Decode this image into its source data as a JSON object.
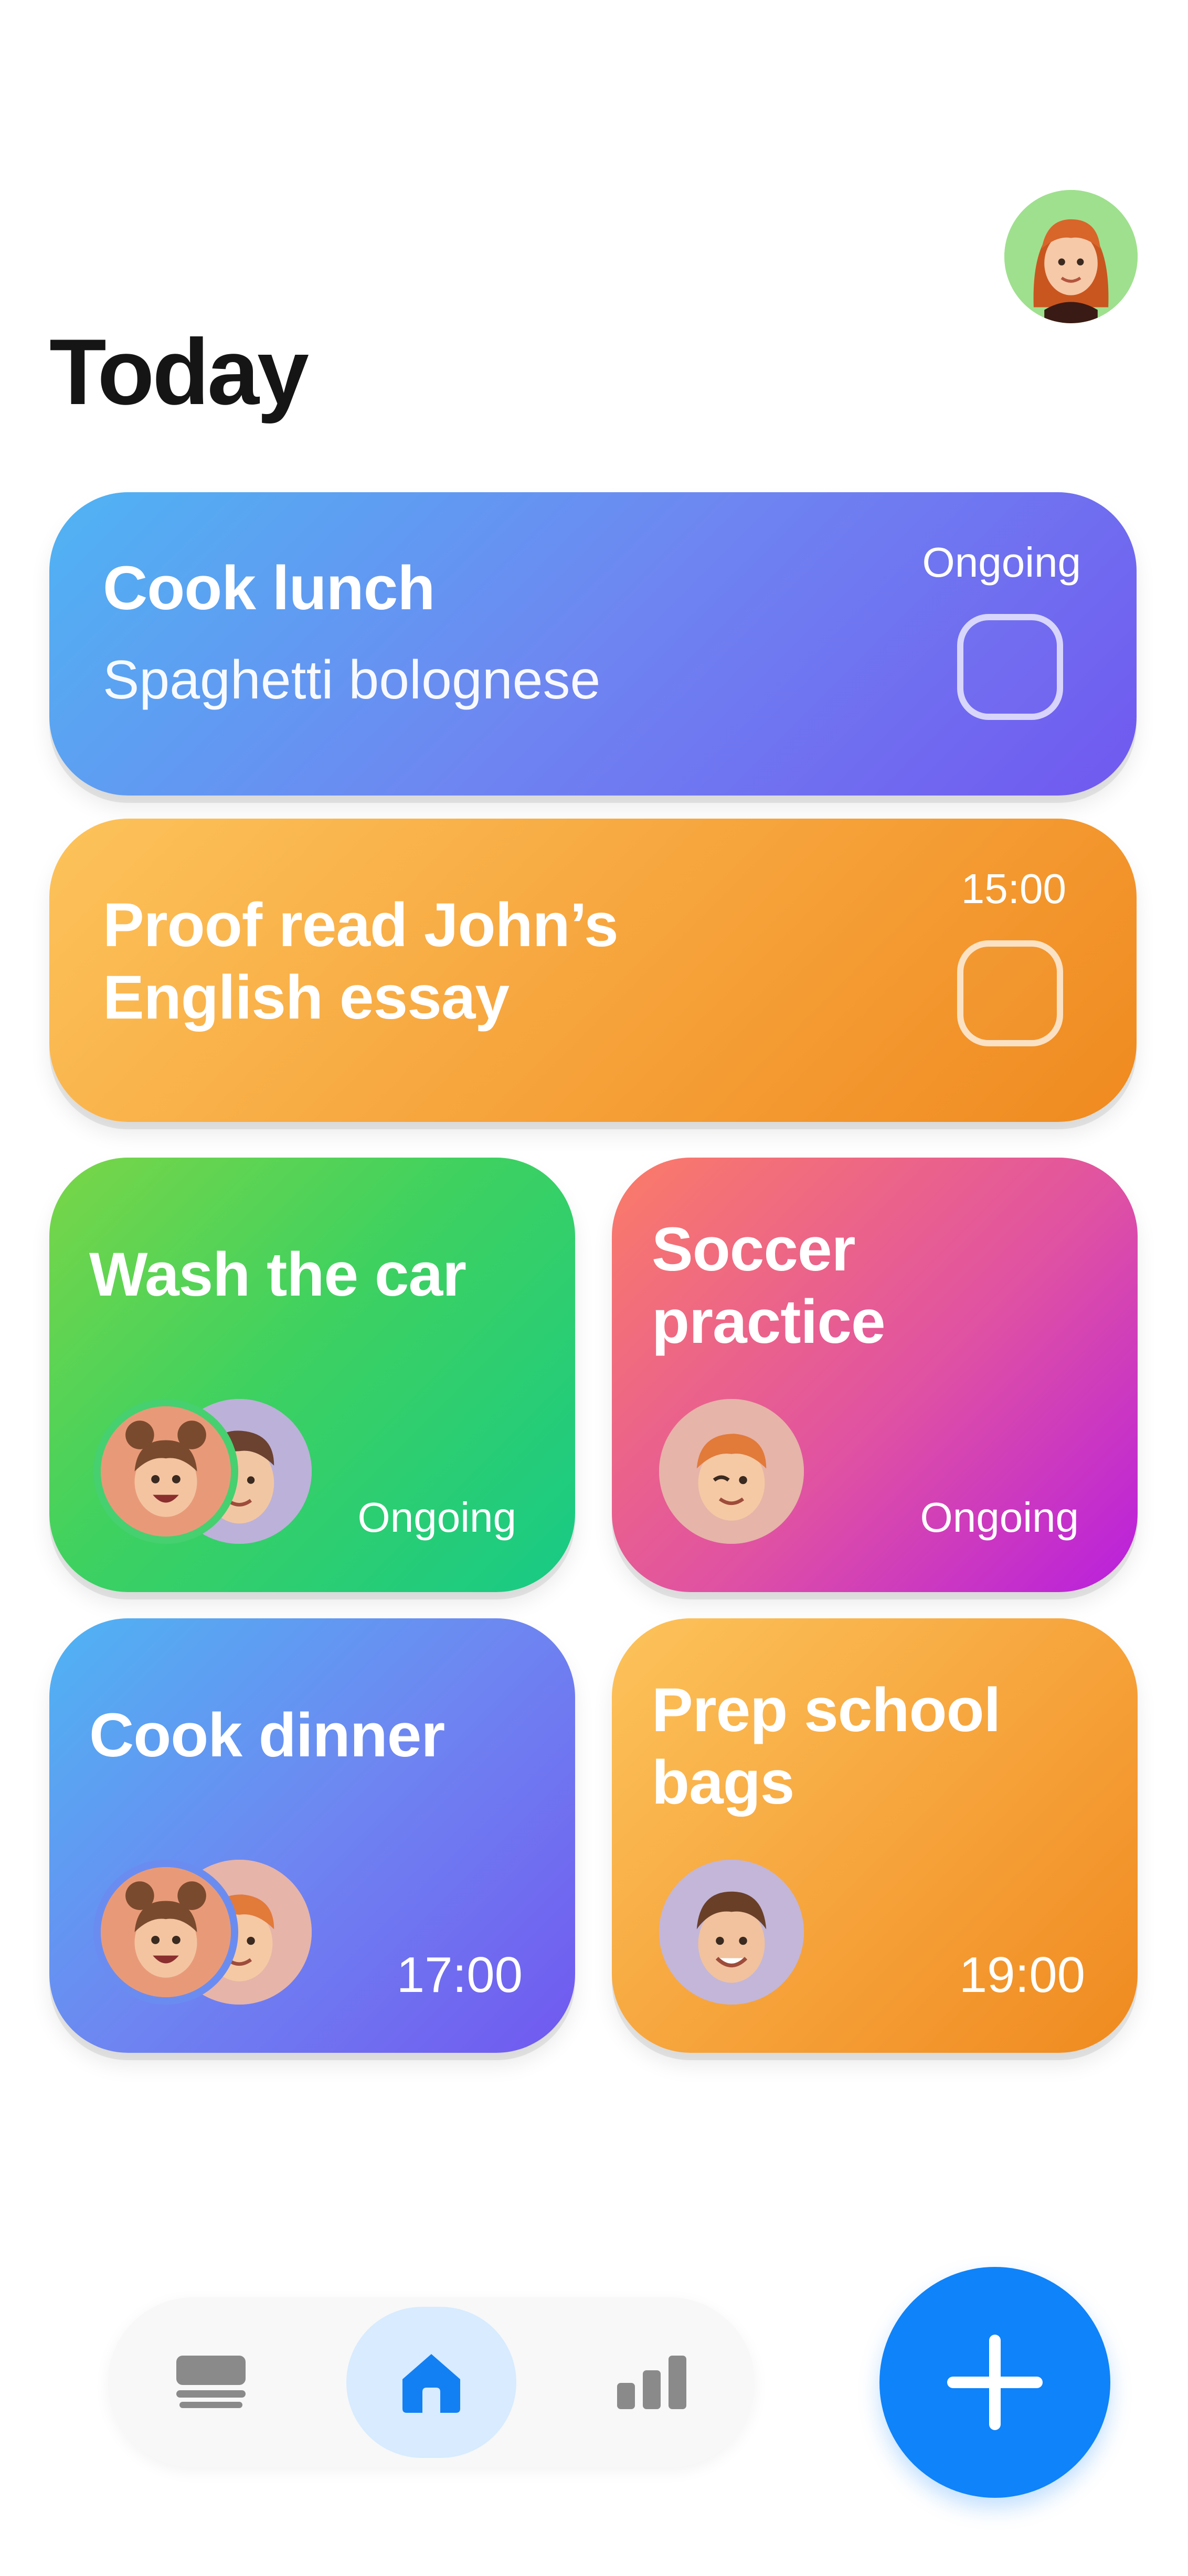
{
  "header": {
    "title": "Today",
    "profile_avatar_icon": "memoji-girl-red-hair-icon"
  },
  "tasks": [
    {
      "title": "Cook lunch",
      "subtitle": "Spaghetti bolognese",
      "status": "Ongoing",
      "color": "blue",
      "checked": false
    },
    {
      "title_line1": "Proof read John’s",
      "title_line2": "English essay",
      "status": "15:00",
      "color": "orange",
      "checked": false
    },
    {
      "title": "Wash the car",
      "status": "Ongoing",
      "color": "green",
      "assignees": [
        "memoji-girl-buns-icon",
        "memoji-boy-icon"
      ]
    },
    {
      "title_line1": "Soccer",
      "title_line2": "practice",
      "status": "Ongoing",
      "color": "pink",
      "assignees": [
        "memoji-boy-winking-icon"
      ]
    },
    {
      "title": "Cook dinner",
      "status": "17:00",
      "color": "blue",
      "assignees": [
        "memoji-girl-buns-icon",
        "memoji-boy-ginger-icon"
      ]
    },
    {
      "title_line1": "Prep school",
      "title_line2": "bags",
      "status": "19:00",
      "color": "orange",
      "assignees": [
        "memoji-man-icon"
      ]
    }
  ],
  "colors": {
    "blue": "#6e86f1",
    "orange": "#f6a23a",
    "green": "#3ed160",
    "pink": "#e052a2",
    "accent": "#0f83f9",
    "nav_active_bg": "#d8ebff"
  },
  "bottom_nav": {
    "items": [
      {
        "icon": "stack-icon",
        "active": false
      },
      {
        "icon": "home-icon",
        "active": true
      },
      {
        "icon": "bar-chart-icon",
        "active": false
      }
    ],
    "fab_icon": "plus-icon"
  }
}
